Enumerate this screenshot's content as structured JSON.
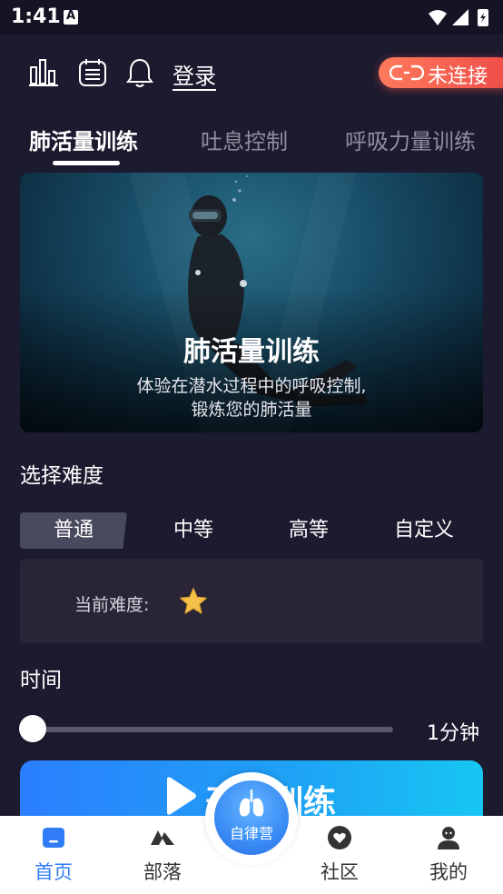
{
  "status_bar": {
    "time": "1:41"
  },
  "header": {
    "login_label": "登录",
    "connection_label": "未连接"
  },
  "tabs": [
    {
      "label": "肺活量训练",
      "active": true
    },
    {
      "label": "吐息控制",
      "active": false
    },
    {
      "label": "呼吸力量训练",
      "active": false
    }
  ],
  "hero": {
    "title": "肺活量训练",
    "description_line1": "体验在潜水过程中的呼吸控制,",
    "description_line2": "锻炼您的肺活量"
  },
  "difficulty": {
    "section_label": "选择难度",
    "options": [
      "普通",
      "中等",
      "高等",
      "自定义"
    ],
    "selected": "普通",
    "current_label": "当前难度:",
    "current_stars": 1
  },
  "time": {
    "section_label": "时间",
    "duration_label": "1分钟",
    "slider_value": 0
  },
  "start_button": {
    "label": "开始训练"
  },
  "bottom_nav": {
    "items": [
      {
        "label": "首页",
        "icon": "home-icon",
        "active": true
      },
      {
        "label": "部落",
        "icon": "tribe-icon",
        "active": false
      },
      {
        "label": "社区",
        "icon": "community-icon",
        "active": false
      },
      {
        "label": "我的",
        "icon": "profile-icon",
        "active": false
      }
    ],
    "center_label": "自律营",
    "center_icon": "lungs-icon"
  },
  "colors": {
    "background": "#1c1a2e",
    "accent_blue": "#2f7cf6",
    "disconnected_pill": "#ee4b48"
  }
}
